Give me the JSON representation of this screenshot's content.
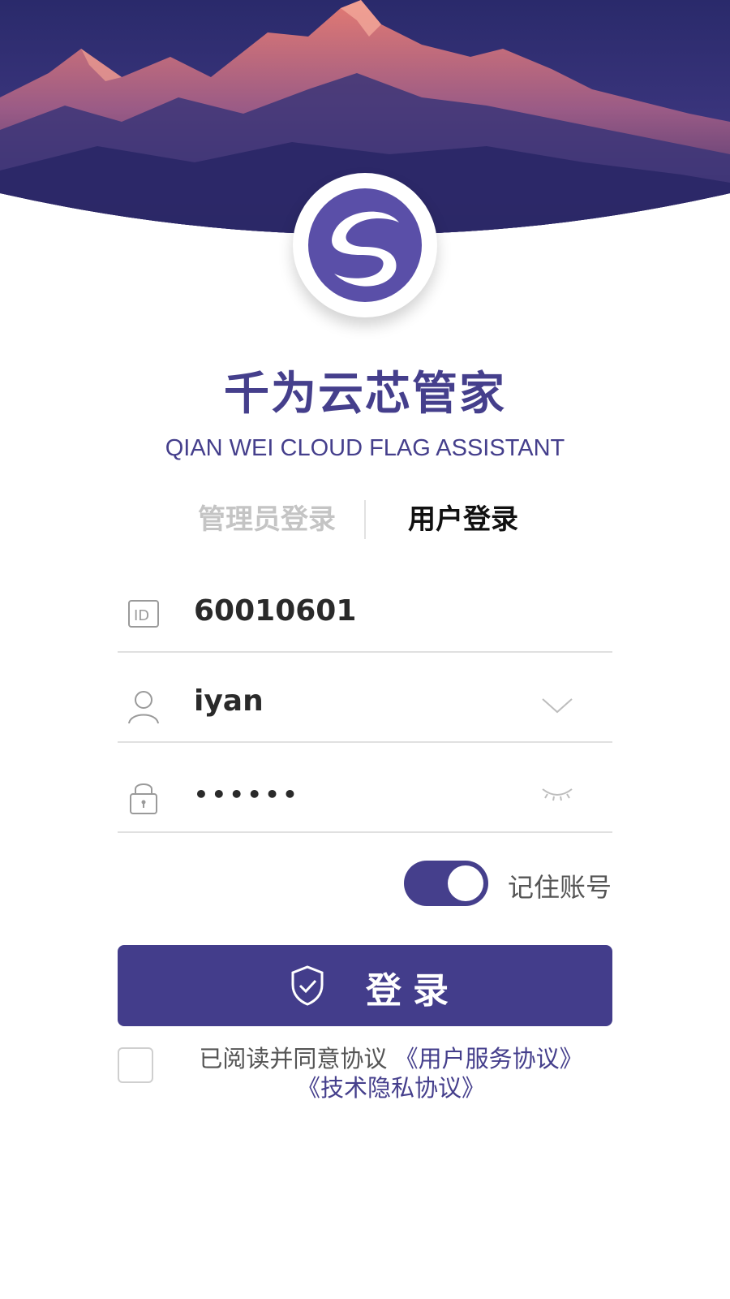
{
  "app": {
    "title": "千为云芯管家",
    "subtitle": "QIAN WEI CLOUD FLAG ASSISTANT",
    "logo_icon": "swirl-logo-icon",
    "brand_color": "#453f8c"
  },
  "tabs": [
    {
      "label": "管理员登录",
      "active": false
    },
    {
      "label": "用户登录",
      "active": true
    }
  ],
  "form": {
    "id_field": {
      "icon": "id-card-icon",
      "value": "60010601"
    },
    "user_field": {
      "icon": "user-icon",
      "value": "iyan",
      "dropdown_icon": "chevron-down-icon"
    },
    "password_field": {
      "icon": "lock-icon",
      "value": "••••••",
      "visibility_icon": "eye-closed-icon"
    }
  },
  "remember": {
    "label": "记住账号",
    "enabled": true
  },
  "login_button": {
    "label": "登录",
    "icon": "shield-check-icon"
  },
  "agreement": {
    "checked": false,
    "prefix": "已阅读并同意协议",
    "link1": "《用户服务协议》",
    "link2": "《技术隐私协议》"
  }
}
